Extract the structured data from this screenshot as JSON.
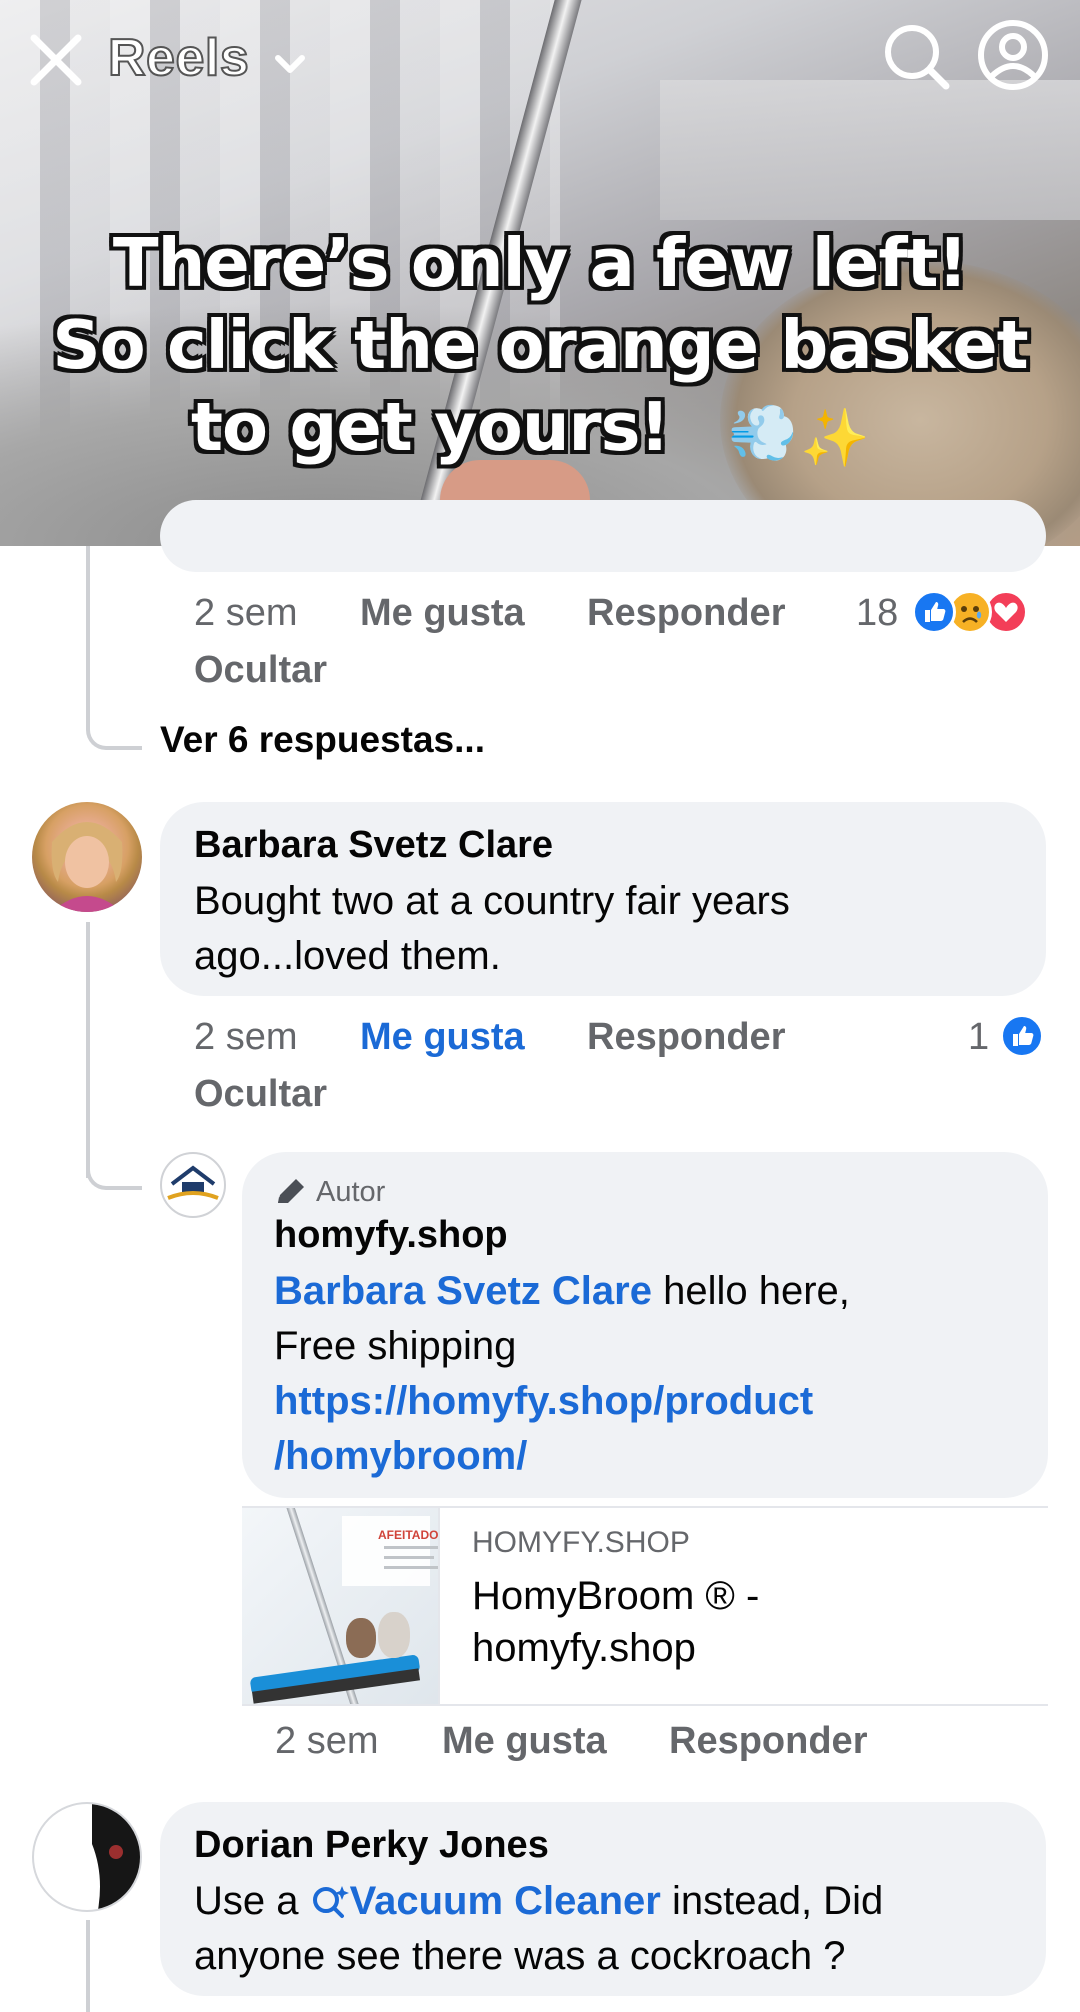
{
  "header": {
    "title": "Reels",
    "caption": [
      "There’s only a few left!",
      "So click the orange basket",
      "to get yours!"
    ]
  },
  "comment_prev": {
    "time": "2 sem",
    "like": "Me gusta",
    "reply": "Responder",
    "hide": "Ocultar",
    "reaction_count": "18",
    "view_replies": "Ver 6 respuestas..."
  },
  "comment_barbara": {
    "name": "Barbara Svetz Clare",
    "text": "Bought two at a country fair years ago...loved them.",
    "time": "2 sem",
    "like": "Me gusta",
    "reply": "Responder",
    "hide": "Ocultar",
    "reaction_count": "1"
  },
  "reply_homyfy": {
    "badge": "Autor",
    "name": "homyfy.shop",
    "mention": "Barbara Svetz Clare",
    "text_after_mention": " hello here,",
    "text_line2": "Free shipping",
    "link_line1": "https://homyfy.shop/product",
    "link_line2": "/homybroom/",
    "preview": {
      "domain": "HOMYFY.SHOP",
      "title": "HomyBroom ® - homyfy.shop",
      "image_label": "AFEITADO"
    },
    "time": "2 sem",
    "like": "Me gusta",
    "reply": "Responder"
  },
  "comment_dorian": {
    "name": "Dorian Perky Jones",
    "text_before": "Use a ",
    "search_link": "Vacuum Cleaner",
    "text_after": " instead, Did",
    "text_line2": "anyone see there was a cockroach ?"
  },
  "colors": {
    "link_blue": "#1b6ad6",
    "bubble_bg": "#f0f2f5",
    "meta_gray": "#65676b",
    "like_blue": "#1877f2",
    "love_red": "#f33e58",
    "sad_yellow": "#f7b125"
  }
}
